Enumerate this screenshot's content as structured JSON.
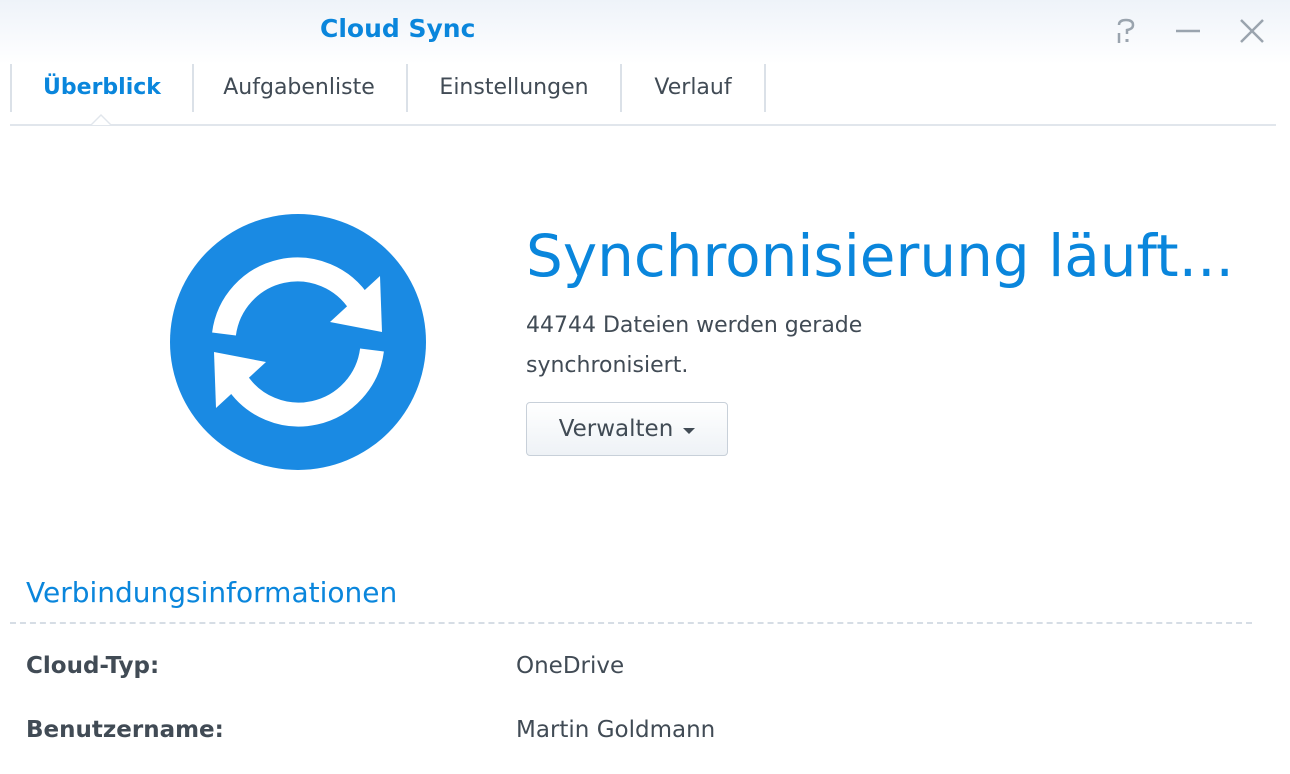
{
  "window": {
    "title": "Cloud Sync",
    "controls": [
      "help-icon",
      "minimize-icon",
      "close-icon"
    ]
  },
  "tabs": [
    {
      "label": "Überblick",
      "active": true
    },
    {
      "label": "Aufgabenliste",
      "active": false
    },
    {
      "label": "Einstellungen",
      "active": false
    },
    {
      "label": "Verlauf",
      "active": false
    }
  ],
  "status": {
    "icon": "sync-icon",
    "title": "Synchronisierung läuft...",
    "description": "44744 Dateien werden gerade synchronisiert.",
    "manage_button": "Verwalten"
  },
  "connection": {
    "section_title": "Verbindungsinformationen",
    "rows": [
      {
        "label": "Cloud-Typ:",
        "value": "OneDrive"
      },
      {
        "label": "Benutzername:",
        "value": "Martin Goldmann"
      }
    ]
  },
  "colors": {
    "accent": "#0a86dc",
    "icon_circle": "#1a8ae3",
    "text": "#414b55"
  }
}
